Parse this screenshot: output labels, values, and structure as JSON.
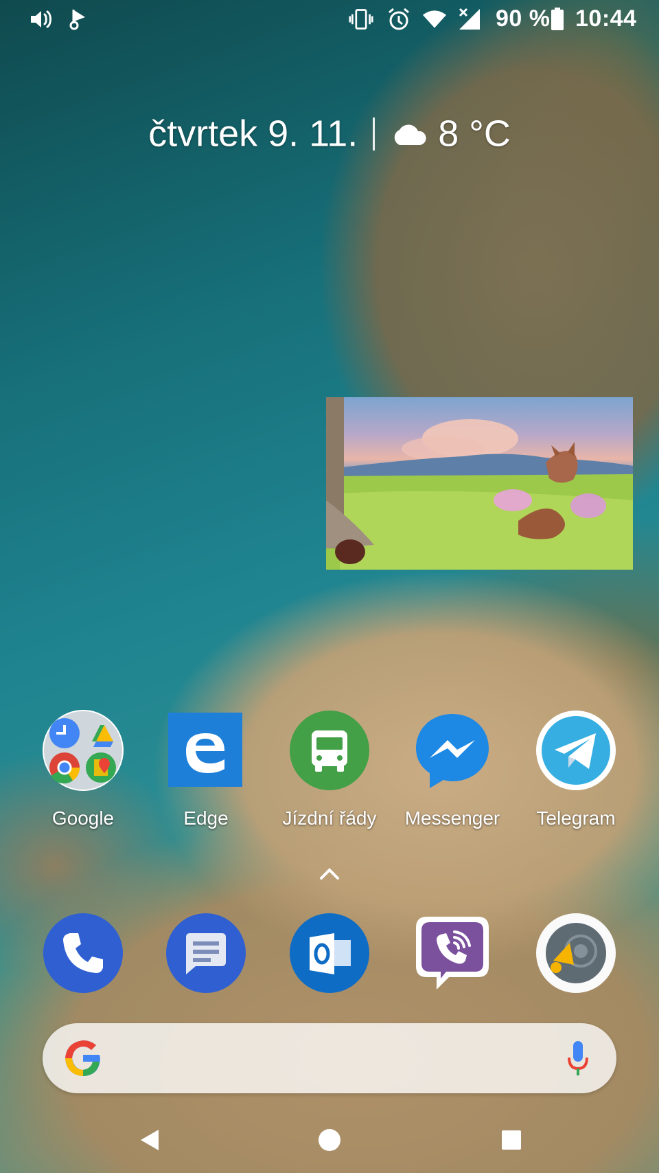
{
  "status_bar": {
    "icons_left": [
      "volume-icon",
      "notification-app-icon"
    ],
    "icons_right": [
      "vibrate-icon",
      "alarm-icon",
      "wifi-icon",
      "cellular-no-data-icon",
      "battery-icon"
    ],
    "battery_percent": "90 %",
    "time": "10:44"
  },
  "at_a_glance": {
    "date": "čtvrtek 9. 11.",
    "weather_icon": "cloud-icon",
    "temperature": "8 °C"
  },
  "pip_video": {
    "content": "animated-video-frame"
  },
  "apps_row": [
    {
      "label": "Google",
      "icon": "google-folder-icon"
    },
    {
      "label": "Edge",
      "icon": "edge-icon"
    },
    {
      "label": "Jízdní řády",
      "icon": "bus-icon"
    },
    {
      "label": "Messenger",
      "icon": "messenger-icon"
    },
    {
      "label": "Telegram",
      "icon": "telegram-icon"
    }
  ],
  "dock": [
    {
      "icon": "phone-icon"
    },
    {
      "icon": "messages-icon"
    },
    {
      "icon": "outlook-icon"
    },
    {
      "icon": "viber-icon"
    },
    {
      "icon": "podcast-icon"
    }
  ],
  "search_bar": {
    "logo": "google-g-icon",
    "mic": "mic-icon"
  },
  "nav_bar": [
    "back-icon",
    "home-icon",
    "recents-icon"
  ],
  "colors": {
    "edge": "#1e7fd8",
    "bus": "#43a047",
    "messenger": "#1e88e5",
    "telegram": "#37aee2",
    "phone": "#2f5fd1",
    "messages": "#2f5fd1",
    "outlook": "#0f6cc5",
    "viber": "#7b519d"
  }
}
